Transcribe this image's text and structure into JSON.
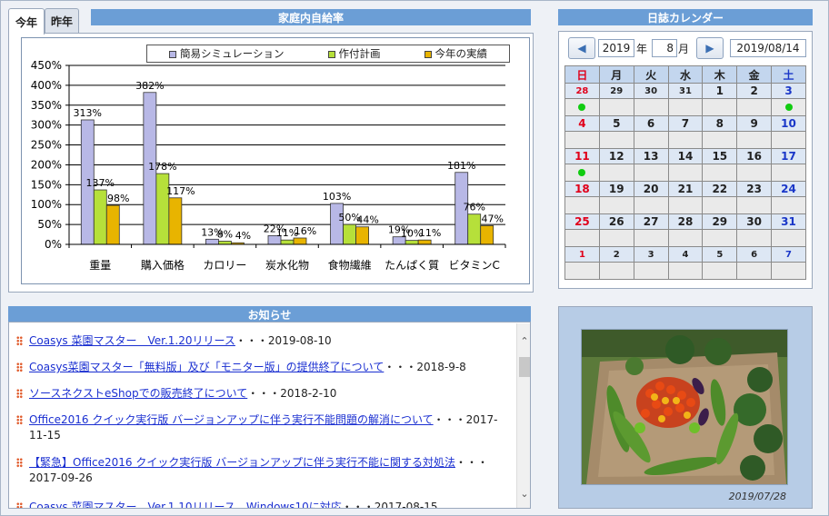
{
  "tabs": [
    {
      "label": "今年"
    },
    {
      "label": "昨年"
    }
  ],
  "self_sufficiency": {
    "title": "家庭内自給率"
  },
  "legend": [
    {
      "label": "簡易シミュレーション",
      "color": "#b8b8e6"
    },
    {
      "label": "作付計画",
      "color": "#b6e03a"
    },
    {
      "label": "今年の実績",
      "color": "#e8b400"
    }
  ],
  "chart_data": {
    "type": "bar",
    "ylim": [
      0,
      450
    ],
    "yticks": [
      "0%",
      "50%",
      "100%",
      "150%",
      "200%",
      "250%",
      "300%",
      "350%",
      "400%",
      "450%"
    ],
    "categories": [
      "重量",
      "購入価格",
      "カロリー",
      "炭水化物",
      "食物繊維",
      "たんぱく質",
      "ビタミンC"
    ],
    "series": [
      {
        "name": "簡易シミュレーション",
        "values": [
          313,
          382,
          13,
          22,
          103,
          19,
          181
        ],
        "labels": [
          "313%",
          "382%",
          "13%",
          "22%",
          "103%",
          "19%",
          "181%"
        ],
        "color": "#b8b8e6"
      },
      {
        "name": "作付計画",
        "values": [
          137,
          178,
          8,
          11,
          50,
          10,
          76
        ],
        "labels": [
          "137%",
          "178%",
          "8%",
          "11%",
          "50%",
          "10%",
          "76%"
        ],
        "color": "#b6e03a"
      },
      {
        "name": "今年の実績",
        "values": [
          98,
          117,
          4,
          16,
          44,
          11,
          47
        ],
        "labels": [
          "98%",
          "117%",
          "4%",
          "16%",
          "44%",
          "11%",
          "47%"
        ],
        "color": "#e8b400"
      }
    ]
  },
  "calendar": {
    "title": "日誌カレンダー",
    "prev_icon": "◀",
    "next_icon": "▶",
    "year": "2019",
    "year_suffix": "年",
    "month": "8",
    "month_suffix": "月",
    "date_field": "2019/08/14",
    "weekdays": [
      "日",
      "月",
      "火",
      "水",
      "木",
      "金",
      "土"
    ],
    "weeks": [
      {
        "days": [
          "28",
          "29",
          "30",
          "31",
          "1",
          "2",
          "3"
        ],
        "memo_dots": [
          0,
          6
        ],
        "other_month": [
          0,
          1,
          2,
          3
        ]
      },
      {
        "days": [
          "4",
          "5",
          "6",
          "7",
          "8",
          "9",
          "10"
        ],
        "memo_dots": [],
        "other_month": []
      },
      {
        "days": [
          "11",
          "12",
          "13",
          "14",
          "15",
          "16",
          "17"
        ],
        "memo_dots": [
          0
        ],
        "other_month": []
      },
      {
        "days": [
          "18",
          "19",
          "20",
          "21",
          "22",
          "23",
          "24"
        ],
        "memo_dots": [],
        "other_month": []
      },
      {
        "days": [
          "25",
          "26",
          "27",
          "28",
          "29",
          "30",
          "31"
        ],
        "memo_dots": [],
        "other_month": []
      },
      {
        "days": [
          "1",
          "2",
          "3",
          "4",
          "5",
          "6",
          "7"
        ],
        "memo_dots": [],
        "other_month": [
          0,
          1,
          2,
          3,
          4,
          5,
          6
        ]
      }
    ]
  },
  "news": {
    "title": "お知らせ",
    "items": [
      {
        "link": "Coasys 菜園マスター　Ver.1.20リリース",
        "date": "・・・2019-08-10"
      },
      {
        "link": "Coasys菜園マスター「無料版」及び「モニター版」の提供終了について",
        "date": "・・・2018-9-8"
      },
      {
        "link": "ソースネクストeShopでの販売終了について",
        "date": "・・・2018-2-10"
      },
      {
        "link": "Office2016 クイック実行版 バージョンアップに伴う実行不能問題の解消について",
        "date": "・・・2017-11-15"
      },
      {
        "link": "【緊急】Office2016 クイック実行版 バージョンアップに伴う実行不能に関する対処法",
        "date": "・・・2017-09-26"
      },
      {
        "link": "Coasys 菜園マスター　Ver.1.10リリース　Windows10に対応",
        "date": "・・・2017-08-15"
      }
    ]
  },
  "photo": {
    "date": "2019/07/28"
  }
}
